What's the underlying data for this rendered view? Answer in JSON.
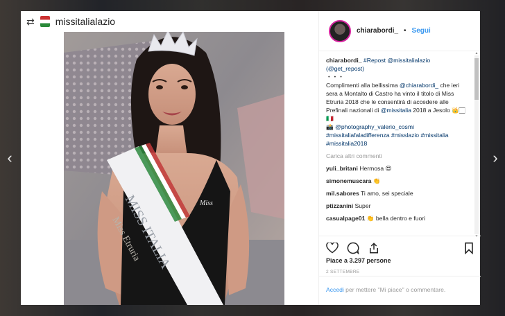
{
  "nav": {
    "prev": "‹",
    "next": "›"
  },
  "repost": {
    "icon": "repost-icon",
    "username": "missitalialazio"
  },
  "header": {
    "username": "chiarabordi_",
    "separator": "•",
    "follow": "Segui"
  },
  "caption": {
    "username": "chiarabordi_",
    "repost_tag": "#Repost",
    "repost_user": "@missitalialazio",
    "get_repost": "(@get_repost)",
    "dots": "・・・",
    "text1": "Complimenti alla bellissima ",
    "mention1": "@chiarabordi_",
    "text2": " che ieri sera a Montalto di Castro ha vinto il titolo di Miss Etruria 2018 che le consentirà di accedere alle Prefinali nazionali di ",
    "mention2": "@missitalia",
    "text3": " 2018 a Jesolo 👑🏻🇮🇹",
    "text4": "📸 ",
    "mention3": "@photography_valerio_cosmi",
    "hashtags": "#missitaliafaladifferenza #misslazio #missitalia #missitalia2018"
  },
  "load_more": "Carica altri commenti",
  "comments": [
    {
      "user": "yuli_britani",
      "text": "Hermosa 😍"
    },
    {
      "user": "simonemuscara",
      "text": "👏"
    },
    {
      "user": "mil.sabores",
      "text": "Ti amo, sei speciale"
    },
    {
      "user": "ptizzanini",
      "text": "Super"
    },
    {
      "user": "casualpage01",
      "text": "👏 bella dentro e fuori"
    }
  ],
  "actions": {
    "like_icon": "heart-icon",
    "comment_icon": "comment-icon",
    "share_icon": "share-icon",
    "save_icon": "bookmark-icon",
    "likes": "Piace a 3.297 persone",
    "date": "2 SETTEMBRE"
  },
  "add_comment": {
    "login": "Accedi",
    "rest": " per mettere \"Mi piace\" o commentare."
  },
  "photo": {
    "sash_line1": "MISS ITALIA",
    "sash_line2": "Miss Etruria",
    "suit_logo": "Miss"
  },
  "colors": {
    "accent": "#3897f0",
    "text": "#262626",
    "muted": "#999999"
  }
}
